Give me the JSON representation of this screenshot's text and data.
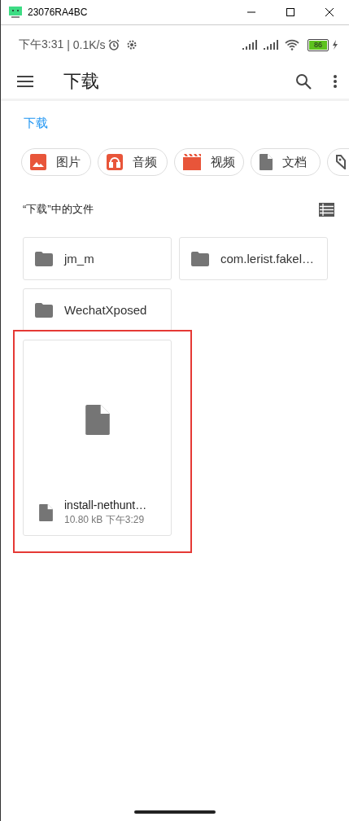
{
  "window": {
    "title": "23076RA4BC"
  },
  "status_bar": {
    "time": "下午3:31",
    "speed": "| 0.1K/s",
    "battery": "86"
  },
  "app_bar": {
    "title": "下载"
  },
  "breadcrumb": "下载",
  "chips": [
    {
      "kind": "image",
      "label": "图片"
    },
    {
      "kind": "audio",
      "label": "音频"
    },
    {
      "kind": "video",
      "label": "视频"
    },
    {
      "kind": "document",
      "label": "文档"
    },
    {
      "kind": "tag"
    }
  ],
  "section": {
    "title": "“下载”中的文件"
  },
  "items": [
    {
      "kind": "folder",
      "name": "jm_m"
    },
    {
      "kind": "folder",
      "name": "com.lerist.fakel…"
    },
    {
      "kind": "folder",
      "name": "WechatXposed"
    },
    {
      "kind": "file",
      "name": "install-nethunt…",
      "size": "10.80 kB",
      "time": "下午3:29",
      "highlighted": true
    }
  ]
}
